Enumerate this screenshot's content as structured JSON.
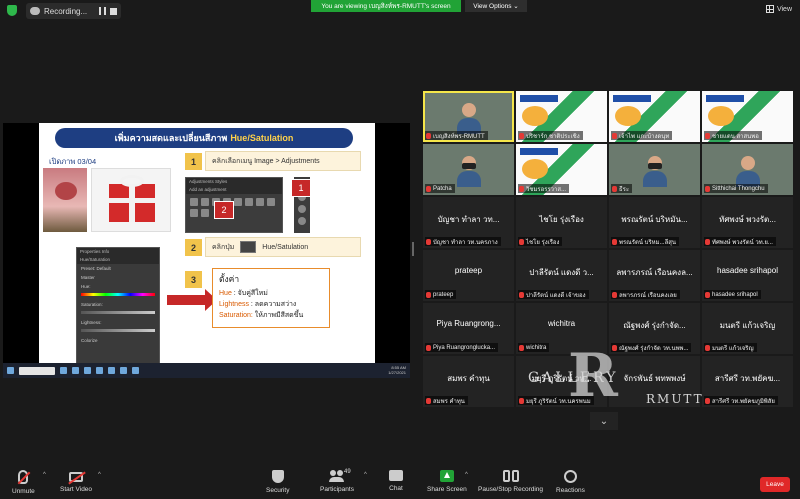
{
  "topbar": {
    "recording_label": "Recording...",
    "viewing_banner": "You are viewing เบญสิงห์พร-RMUTT's screen",
    "view_options": "View Options",
    "view_options_caret": "⌄",
    "view_label": "View"
  },
  "slide": {
    "title_main": "เพิ่มความสดและเปลี่ยนสีภาพ",
    "title_highlight": "Hue/Satulation",
    "subtitle": "เปิดภาพ 03/04",
    "step1": {
      "num": "1",
      "text": "คลิกเลือกเมนู Image > Adjustments"
    },
    "step2": {
      "num": "2",
      "text_a": "คลิกปุ่ม",
      "text_b": "Hue/Satulation"
    },
    "step3": {
      "num": "3"
    },
    "badge1": "1",
    "badge2": "2",
    "ps_menu_title": "Adjustments   Styles",
    "ps_menu_sub": "Add an adjustment",
    "props_title": "Properties   Info",
    "props_sub": "Hue/Saturation",
    "props_preset_label": "Preset:",
    "props_preset_value": "Default",
    "props_channel": "Master",
    "props_hue": "Hue:",
    "props_saturation": "Saturation:",
    "props_lightness": "Lightness:",
    "props_colorize": "Colorize",
    "notes": {
      "heading": "ตั้งค่า",
      "hue_key": "Hue",
      "hue_val": " : จับคู่สีใหม่",
      "light_key": "Lightness",
      "light_val": " : ลดความสว่าง",
      "sat_key": "Saturation:",
      "sat_val": " ให้ภาพมีสีสดขึ้น"
    },
    "taskbar_time": "8:55 AM",
    "taskbar_date": "1/27/2021"
  },
  "participants": [
    {
      "name": "เบญสิงห์พร-RMUTT",
      "big": "",
      "kind": "video",
      "active": true
    },
    {
      "name": "ปริชาร์ก ชาติประเชิง",
      "big": "",
      "kind": "poster"
    },
    {
      "name": "เจ้าไพ แกะบ้างดนุท",
      "big": "",
      "kind": "poster"
    },
    {
      "name": "ชายแดน สาสนพอ",
      "big": "",
      "kind": "poster"
    },
    {
      "name": "Patcha",
      "big": "",
      "kind": "video"
    },
    {
      "name": "วิชมรอรรวาส...",
      "big": "",
      "kind": "poster"
    },
    {
      "name": "ธีระ",
      "big": "",
      "kind": "video"
    },
    {
      "name": "Sitthichai Thongchu",
      "big": "",
      "kind": "video"
    },
    {
      "name": "บัญชา ทำลา วท.นครภาง",
      "big": "บัญชา ทำลา วท...",
      "kind": "name"
    },
    {
      "name": "ไชโย รุ่งเรือง",
      "big": "ไชโย รุ่งเรือง",
      "kind": "name"
    },
    {
      "name": "พรณรัตน์ บริหม...ลีสุน",
      "big": "พรณรัตน์ บริหมัน...",
      "kind": "name"
    },
    {
      "name": "ทัศพงษ์ พวงรัตน์ วท.ย...",
      "big": "ทัศพงษ์ พวงรัต...",
      "kind": "name"
    },
    {
      "name": "prateep",
      "big": "prateep",
      "kind": "name"
    },
    {
      "name": "ปาลีรัตน์ แดงดี เจ้าของ",
      "big": "ปาลีรัตน์ แดงดี ว...",
      "kind": "name"
    },
    {
      "name": "ลพารภรณ์ เรือนคงเลย",
      "big": "ลพารภรณ์ เรือนคงล...",
      "kind": "name"
    },
    {
      "name": "hasadee srihapol",
      "big": "hasadee srihapol",
      "kind": "name"
    },
    {
      "name": "Piya Ruangronglucka...",
      "big": "Piya Ruangrong...",
      "kind": "name"
    },
    {
      "name": "wichitra",
      "big": "wichitra",
      "kind": "name"
    },
    {
      "name": "ณัฐพงศ์ รุ่งกำจัด วท.นพพ...",
      "big": "ณัฐพงศ์ รุ่งกำจัด...",
      "kind": "name"
    },
    {
      "name": "มนตรี แก้วเจริญ",
      "big": "มนตรี แก้วเจริญ",
      "kind": "name"
    },
    {
      "name": "สมพร คำทุน",
      "big": "สมพร คำทุน",
      "kind": "name"
    },
    {
      "name": "มยุรี ภูริรัตน์ วท.นครพนม",
      "big": "มยุรี ภูริรัตน์ วท...",
      "kind": "name"
    },
    {
      "name": "",
      "big": "จักรพันธ์ พทพพงษ์",
      "kind": "name"
    },
    {
      "name": "สารีศรี วท.พยัคฆภูมิพิสัย",
      "big": "สารีศรี วท.พยัคฆ...",
      "kind": "name"
    }
  ],
  "watermark": {
    "big": "R",
    "w1": "GALLERY",
    "w2": "RMUTT"
  },
  "toolbar": {
    "unmute": "Unmute",
    "start_video": "Start Video",
    "security": "Security",
    "participants": "Participants",
    "participants_count": "49",
    "chat": "Chat",
    "share_screen": "Share Screen",
    "record": "Pause/Stop Recording",
    "reactions": "Reactions",
    "leave": "Leave",
    "caret": "^",
    "scroll_down": "⌄"
  },
  "colors": {
    "zoom_green": "#21a336",
    "leave_red": "#e02828",
    "slide_navy": "#1e3e82",
    "active_speaker": "#f5e64a"
  }
}
